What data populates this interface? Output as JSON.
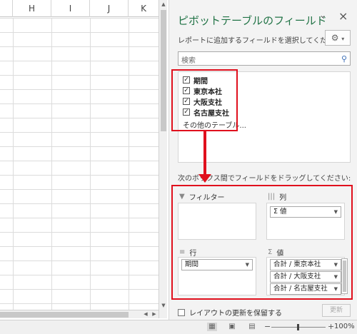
{
  "sheet": {
    "columns": [
      "H",
      "I",
      "J",
      "K"
    ]
  },
  "pane": {
    "title": "ピボットテーブルのフィールド",
    "subtitle": "レポートに追加するフィールドを選択してください:",
    "search_placeholder": "検索",
    "fields": [
      {
        "label": "期間",
        "checked": true
      },
      {
        "label": "東京本社",
        "checked": true
      },
      {
        "label": "大阪支社",
        "checked": true
      },
      {
        "label": "名古屋支社",
        "checked": true
      }
    ],
    "more_tables": "その他のテーブル...",
    "drag_hint": "次のボックス間でフィールドをドラッグしてください:",
    "areas": {
      "filter": {
        "label": "フィルター"
      },
      "columns": {
        "label": "列",
        "items": [
          "Σ 値"
        ]
      },
      "rows": {
        "label": "行",
        "items": [
          "期間"
        ]
      },
      "values": {
        "label": "値",
        "items": [
          "合計 / 東京本社",
          "合計 / 大阪支社",
          "合計 / 名古屋支社"
        ]
      }
    },
    "defer_label": "レイアウトの更新を保留する",
    "update_label": "更新"
  },
  "status": {
    "zoom": "100%"
  },
  "icons": {
    "settings": "gear-icon",
    "search": "search-icon",
    "close": "close-icon"
  },
  "colors": {
    "title_green": "#217346",
    "highlight_red": "#e0101d"
  }
}
